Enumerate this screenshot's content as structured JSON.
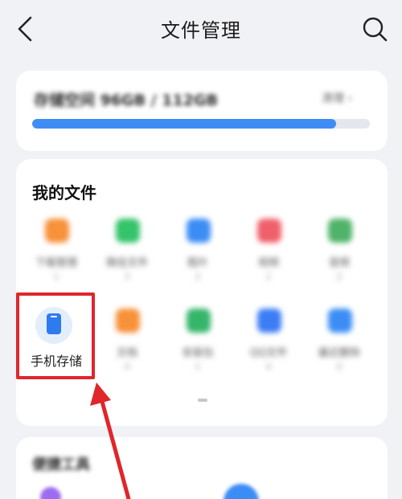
{
  "header": {
    "title": "文件管理"
  },
  "storage": {
    "label": "存储空间 96GB / 112GB",
    "detail": "清理 ›",
    "usage_fraction": 0.9
  },
  "my_files": {
    "title": "我的文件",
    "row1": [
      {
        "label": "下载管理",
        "count": "1",
        "color": "#f7913a"
      },
      {
        "label": "微信文件",
        "count": "3",
        "color": "#35c36b"
      },
      {
        "label": "图片",
        "count": "2",
        "color": "#3b8df5"
      },
      {
        "label": "视频",
        "count": "1",
        "color": "#f0606a"
      },
      {
        "label": "音频",
        "count": "2",
        "color": "#4fb36a"
      }
    ],
    "row2": [
      {
        "label": "文档",
        "count": "4",
        "color": "#f7913a"
      },
      {
        "label": "安装包",
        "count": "1",
        "color": "#35b56a"
      },
      {
        "label": "QQ文件",
        "count": "4",
        "color": "#3b7df5"
      },
      {
        "label": "最近删除",
        "count": "0",
        "color": "#3b8df5"
      }
    ],
    "phone_storage": {
      "label": "手机存储",
      "color": "#2e7bf0"
    }
  },
  "tools": {
    "title": "便捷工具"
  },
  "annotation": {
    "highlight_color": "#e0262b"
  }
}
